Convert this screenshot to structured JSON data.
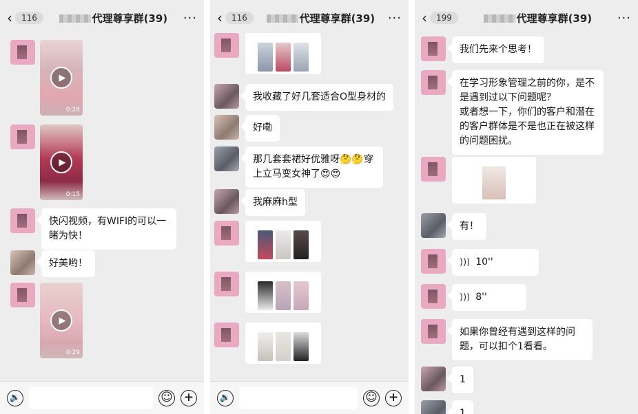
{
  "panels": [
    {
      "unread_count": "116",
      "group_title": "代理尊享群(39)",
      "messages": {
        "video1_duration": "0:28",
        "video2_duration": "0:15",
        "text1": "快闪视频，有WIFI的可以一睹为快！",
        "text2": "好美哟！",
        "video3_duration": "0:29"
      }
    },
    {
      "unread_count": "116",
      "group_title": "代理尊享群(39)",
      "messages": {
        "text1": "我收藏了好几套适合O型身材的",
        "text2": "好嘞",
        "text3": "那几套套裙好优雅呀🤔🤔穿上立马变女神了😍😍",
        "text4": "我麻麻h型"
      }
    },
    {
      "unread_count": "199",
      "group_title": "代理尊享群(39)",
      "messages": {
        "text1": "我们先来个思考！",
        "text2": "在学习形象管理之前的你，是不是遇到过以下问题呢？\n或者想一下，你们的客户和潜在的客户群体是不是也正在被这样的问题困扰。",
        "text3": "有！",
        "voice1": "10''",
        "voice2": "8''",
        "text4": "如果你曾经有遇到这样的问题，可以扣个1看看。",
        "text5": "1",
        "text6": "1"
      }
    }
  ],
  "icons": {
    "back": "chevron-left-icon",
    "more": "more-icon",
    "voice": "voice-icon",
    "emoji": "emoji-icon",
    "plus": "plus-icon",
    "play": "play-icon"
  },
  "colors": {
    "chat_background": "#ededed",
    "bubble": "#ffffff",
    "avatar_pink": "#e9a9c0"
  }
}
